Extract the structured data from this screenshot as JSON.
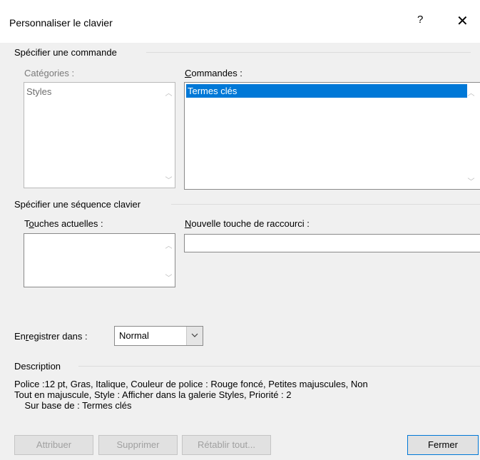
{
  "window": {
    "title": "Personnaliser le clavier",
    "help_label": "?",
    "close_label": "✕"
  },
  "command_section": {
    "heading": "Spécifier une commande",
    "categories_label": "Catégories :",
    "categories_items": [
      "Styles"
    ],
    "commands_label_underlined": "C",
    "commands_label_rest": "ommandes :",
    "commands_items": [
      "Termes clés"
    ]
  },
  "keys_section": {
    "heading": "Spécifier une séquence clavier",
    "current_keys_label_pre": "T",
    "current_keys_label_u": "o",
    "current_keys_label_post": "uches actuelles :",
    "new_key_label_u": "N",
    "new_key_label_rest": "ouvelle touche de raccourci :",
    "new_key_value": ""
  },
  "save_in": {
    "label_pre": "En",
    "label_u": "r",
    "label_post": "egistrer dans :",
    "value": "Normal"
  },
  "description": {
    "heading": "Description",
    "line1": "Police :12 pt, Gras, Italique, Couleur de police : Rouge foncé, Petites majuscules, Non",
    "line2": "Tout en majuscule, Style : Afficher dans la galerie Styles, Priorité : 2",
    "line3": "    Sur base de : Termes clés"
  },
  "buttons": {
    "assign": "Attribuer",
    "remove": "Supprimer",
    "reset_all": "Rétablir tout...",
    "close": "Fermer"
  },
  "icons": {
    "help": "question-mark",
    "close": "x-close",
    "scroll_up": "chevron-up",
    "scroll_down": "chevron-down",
    "dropdown": "chevron-down"
  }
}
